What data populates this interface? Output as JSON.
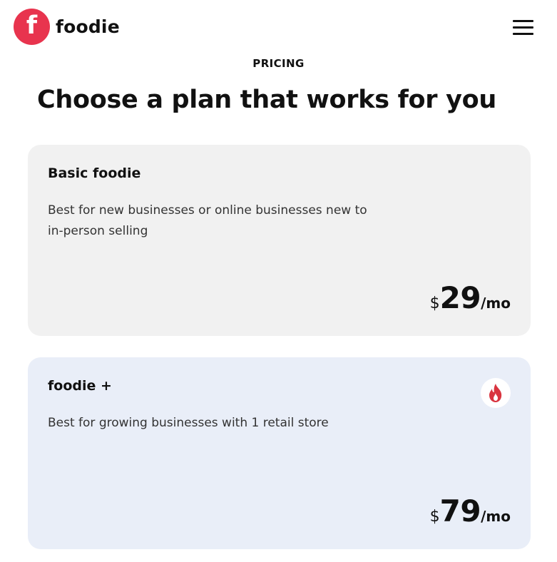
{
  "brand": {
    "logo_letter": "f",
    "name": "foodie",
    "accent_color": "#e8344e"
  },
  "header": {
    "menu_icon": "hamburger-menu-icon"
  },
  "pricing": {
    "eyebrow": "PRICING",
    "headline": "Choose a plan that works for you",
    "plans": [
      {
        "name": "Basic foodie",
        "description": "Best for new businesses or online businesses new to in-person selling",
        "currency": "$",
        "amount": "29",
        "period": "/mo",
        "background": "#f1f1f1"
      },
      {
        "name": "foodie +",
        "description": "Best for growing businesses with 1 retail store",
        "currency": "$",
        "amount": "79",
        "period": "/mo",
        "background": "#e9eef8",
        "badge_icon": "flame-icon",
        "badge_color": "#d9343f"
      }
    ]
  }
}
